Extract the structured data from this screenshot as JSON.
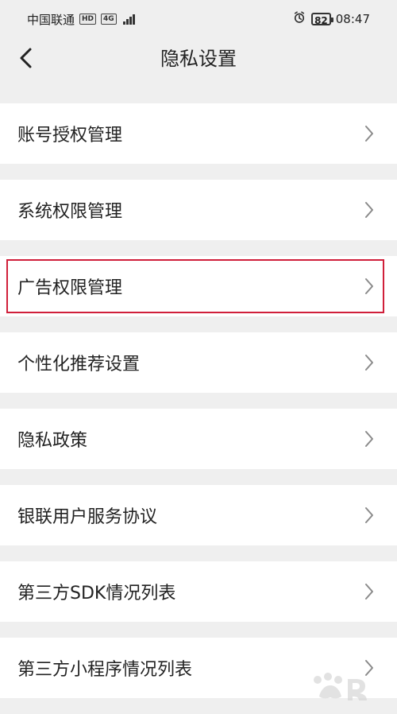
{
  "status_bar": {
    "carrier": "中国联通",
    "hd_badge": "HD",
    "network": "4G",
    "battery": "82",
    "time": "08:47",
    "icons": [
      "hd-badge-icon",
      "network-icon",
      "signal-icon",
      "alarm-icon",
      "battery-icon"
    ]
  },
  "header": {
    "title": "隐私设置",
    "back_icon": "back-icon"
  },
  "menu": {
    "items": [
      {
        "label": "账号授权管理",
        "icon": "chevron-right-icon"
      },
      {
        "label": "系统权限管理",
        "icon": "chevron-right-icon"
      },
      {
        "label": "广告权限管理",
        "icon": "chevron-right-icon",
        "highlight_color": "#d01f3a"
      },
      {
        "label": "个性化推荐设置",
        "icon": "chevron-right-icon"
      },
      {
        "label": "隐私政策",
        "icon": "chevron-right-icon"
      },
      {
        "label": "银联用户服务协议",
        "icon": "chevron-right-icon"
      },
      {
        "label": "第三方SDK情况列表",
        "icon": "chevron-right-icon"
      },
      {
        "label": "第三方小程序情况列表",
        "icon": "chevron-right-icon"
      }
    ]
  },
  "colors": {
    "background": "#efefef",
    "card": "#ffffff",
    "text": "#222222",
    "chevron": "#8a8a8a",
    "highlight": "#d01f3a"
  }
}
